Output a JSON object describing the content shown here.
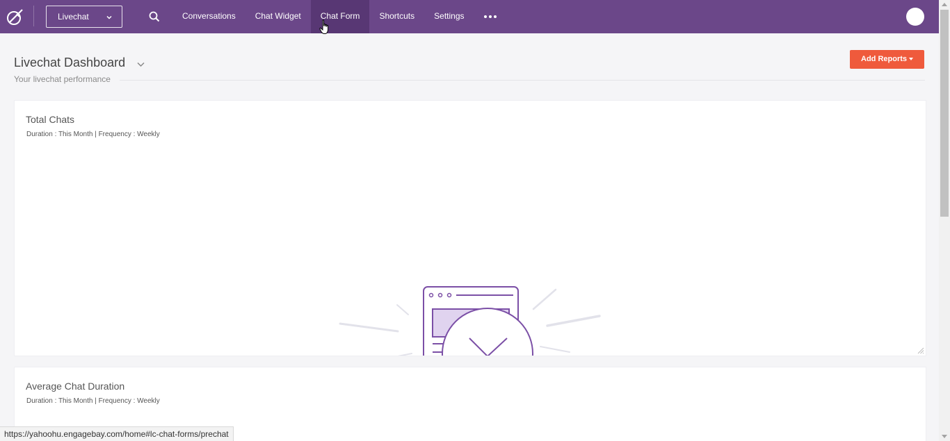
{
  "nav": {
    "app_select": "Livechat",
    "items": [
      {
        "label": "Conversations"
      },
      {
        "label": "Chat Widget"
      },
      {
        "label": "Chat Form"
      },
      {
        "label": "Shortcuts"
      },
      {
        "label": "Settings"
      }
    ],
    "active_item": "Chat Form"
  },
  "header": {
    "title": "Livechat Dashboard",
    "subtitle": "Your livechat performance",
    "add_reports_label": "Add Reports"
  },
  "cards": [
    {
      "title": "Total Chats",
      "meta": "Duration : This Month | Frequency : Weekly"
    },
    {
      "title": "Average Chat Duration",
      "meta": "Duration : This Month | Frequency : Weekly"
    }
  ],
  "status_url": "https://yahoohu.engagebay.com/home#lc-chat-forms/prechat",
  "colors": {
    "nav_bg": "#6b4789",
    "nav_active": "#583774",
    "accent_button": "#ef5a3c",
    "illustration_purple": "#7b4fa6"
  },
  "icons": [
    "logo-icon",
    "chevron-down-icon",
    "search-icon",
    "more-icon",
    "avatar",
    "pointer-cursor-icon",
    "empty-state-illustration"
  ]
}
